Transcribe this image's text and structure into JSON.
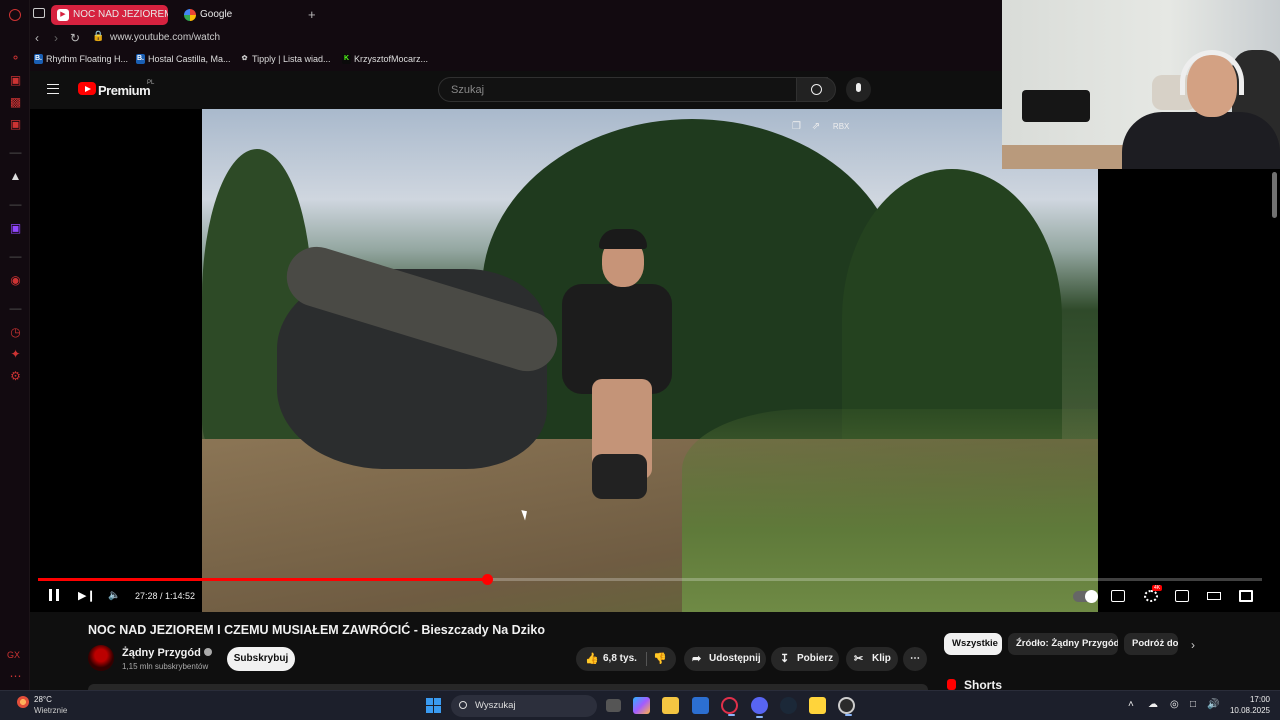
{
  "browser": {
    "tabs": [
      {
        "label": "NOC NAD JEZIOREM I",
        "active": true,
        "favicon": "youtube-icon"
      },
      {
        "label": "Google",
        "active": false,
        "favicon": "google-icon"
      }
    ],
    "new_tab": "+",
    "url": "www.youtube.com/watch",
    "bookmarks": [
      {
        "label": "Rhythm Floating H...",
        "icon": "B.",
        "color": "#1a5fb4"
      },
      {
        "label": "Hostal Castilla, Ma...",
        "icon": "B.",
        "color": "#1a5fb4"
      },
      {
        "label": "Tipply | Lista wiad...",
        "icon": "tipply-icon",
        "color": "#cccccc"
      },
      {
        "label": "KrzysztofMocarz...",
        "icon": "kick-icon",
        "color": "#53fc18"
      }
    ],
    "sidebar_badge": "GX",
    "accent_color": "#d6223f"
  },
  "youtube": {
    "brand": "Premium",
    "country": "PL",
    "search_placeholder": "Szukaj"
  },
  "player": {
    "overlay_label": "RBX",
    "current_time": "27:28",
    "duration": "1:14:52",
    "time_display": "27:28 / 1:14:52",
    "progress_fraction": 0.367,
    "hd_badge": "4K",
    "progress_color": "#ff0000"
  },
  "video": {
    "title": "NOC NAD JEZIOREM I CZEMU MUSIAŁEM ZAWRÓCIĆ - Bieszczady Na Dziko",
    "channel": "Żądny Przygód",
    "subscribers": "1,15 mln subskrybentów",
    "subscribe_label": "Subskrybuj",
    "likes": "6,8 tys.",
    "share_label": "Udostępnij",
    "download_label": "Pobierz",
    "clip_label": "Klip",
    "more_label": "⋯"
  },
  "recommendations": {
    "chips": [
      "Wszystkie",
      "Źródło: Żądny Przygód",
      "Podróż do"
    ],
    "shorts_label": "Shorts"
  },
  "taskbar": {
    "temperature": "28°C",
    "weather": "Wietrznie",
    "search_placeholder": "Wyszukaj",
    "time": "17:00",
    "date": "10.08.2025"
  }
}
